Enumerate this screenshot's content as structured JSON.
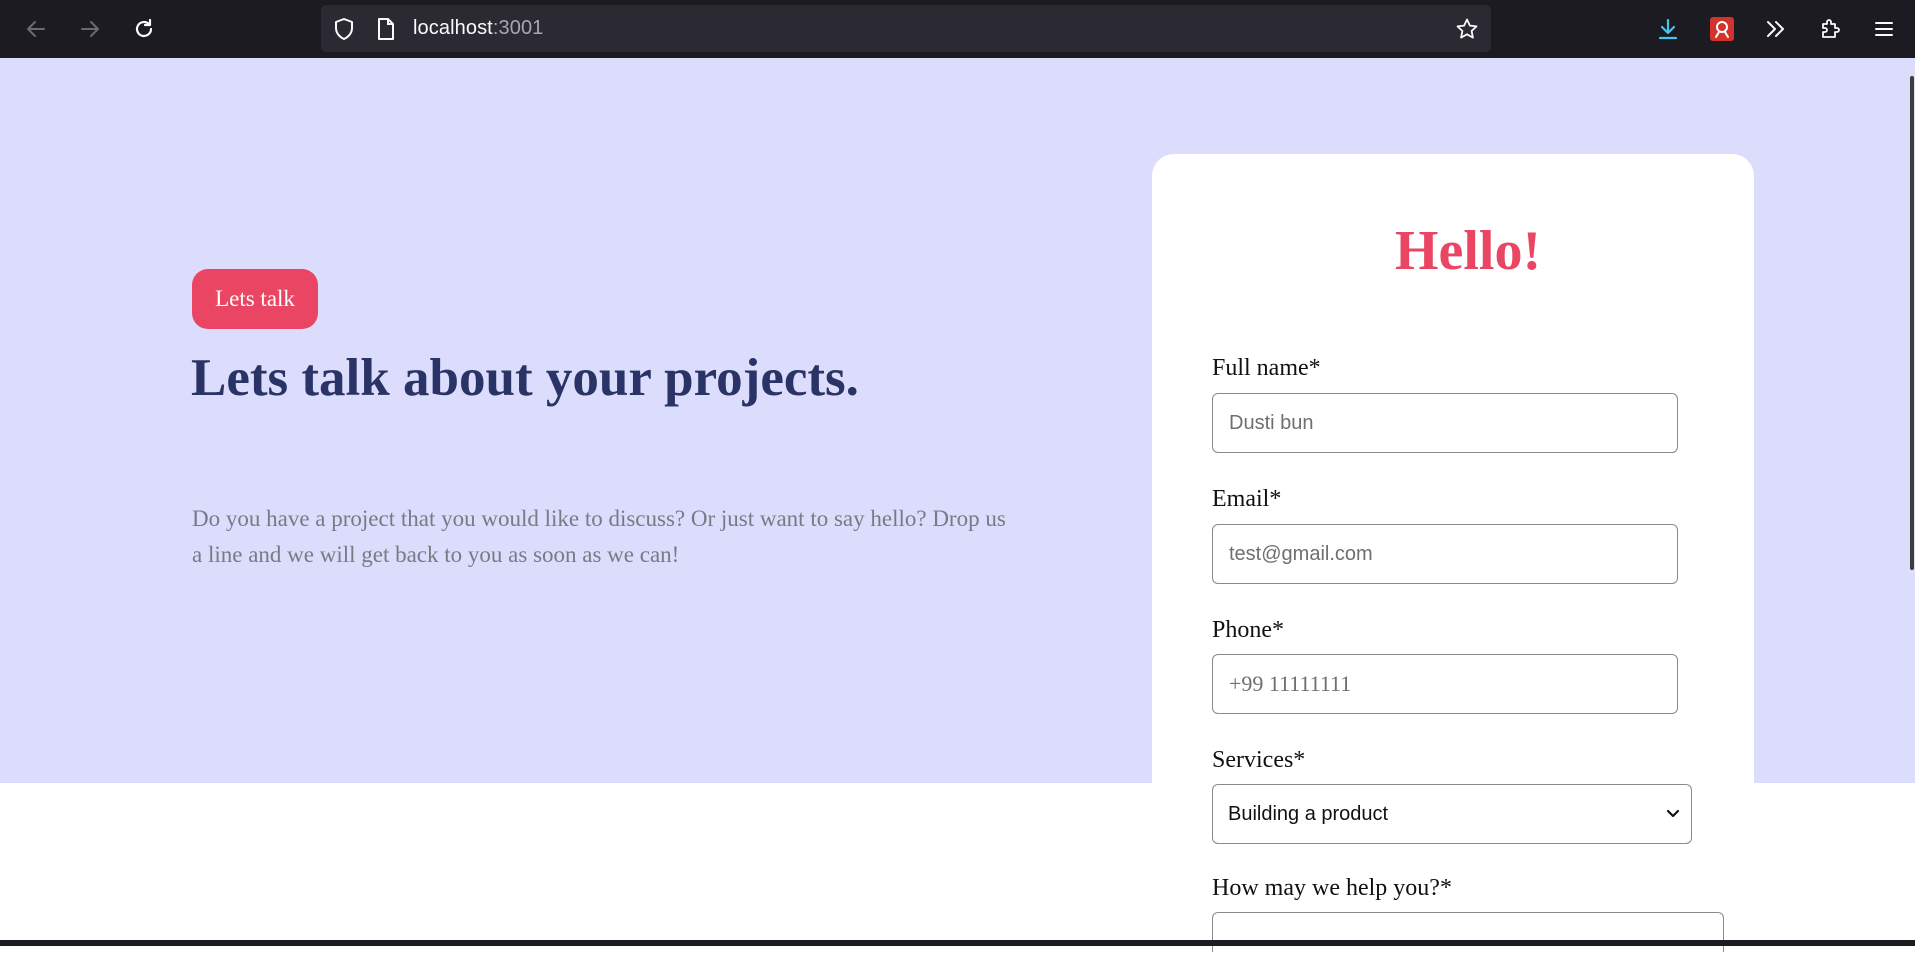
{
  "browser": {
    "url_host": "localhost",
    "url_port": ":3001",
    "back_icon": "arrow-left-icon",
    "forward_icon": "arrow-right-icon",
    "reload_icon": "reload-icon",
    "bookmark_icon": "star-icon",
    "downloads_icon": "download-icon",
    "extensions_icon": "puzzle-icon",
    "menu_icon": "hamburger-icon"
  },
  "hero": {
    "badge": "Lets talk",
    "title": "Lets talk about your projects.",
    "description": "Do you have a project that you would like to discuss? Or just want to say hello? Drop us a line and we will get back to you as soon as we can!"
  },
  "form": {
    "heading": "Hello!",
    "full_name": {
      "label": "Full name*",
      "placeholder": "Dusti bun"
    },
    "email": {
      "label": "Email*",
      "placeholder": "test@gmail.com"
    },
    "phone": {
      "label": "Phone*",
      "placeholder": "+99 11111111"
    },
    "services": {
      "label": "Services*",
      "selected": "Building a product"
    },
    "help": {
      "label": "How may we help you?*"
    }
  },
  "colors": {
    "accent": "#ea4664",
    "title": "#2a3366",
    "hero_bg": "#dcdcfd",
    "chrome_bg": "#1c1b22"
  }
}
